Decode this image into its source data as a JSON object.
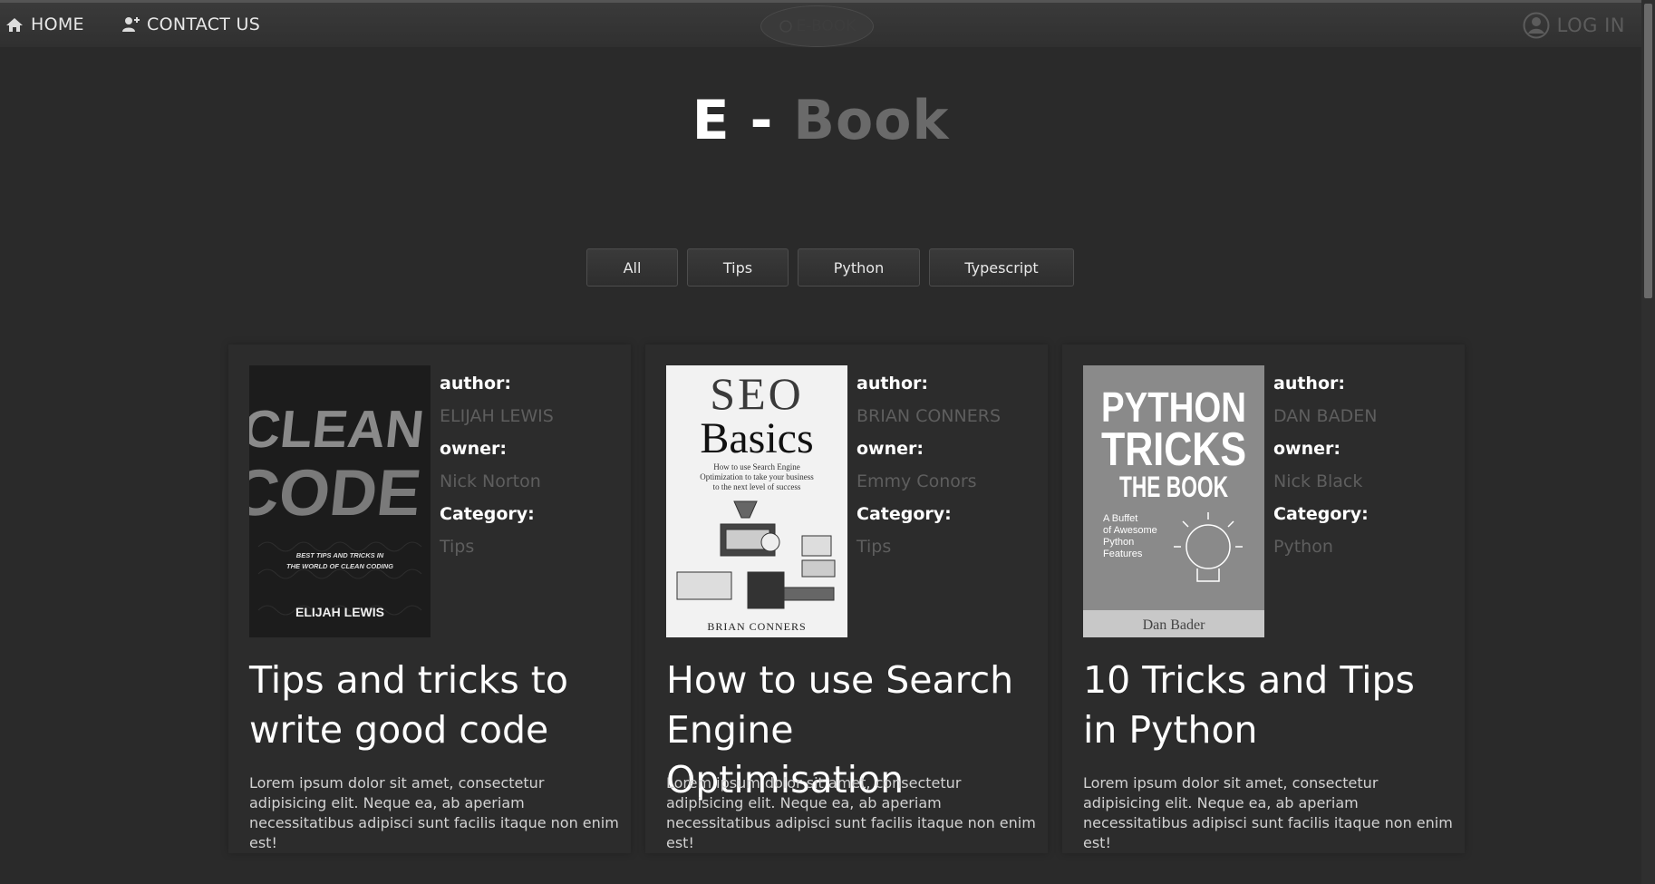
{
  "nav": {
    "home_label": "HOME",
    "contact_label": "CONTACT US",
    "brand_label": "E-BOOK",
    "login_label": "LOG IN"
  },
  "hero": {
    "e": "E",
    "dash": "-",
    "book": "Book"
  },
  "filters": [
    {
      "label": "All"
    },
    {
      "label": "Tips"
    },
    {
      "label": "Python"
    },
    {
      "label": "Typescript"
    }
  ],
  "labels": {
    "author": "author:",
    "owner": "owner:",
    "category": "Category:"
  },
  "books": [
    {
      "author": "ELIJAH LEWIS",
      "owner": "Nick Norton",
      "category": "Tips",
      "title": "Tips and tricks to write good code",
      "description": "Lorem ipsum dolor sit amet, consectetur adipisicing elit. Neque ea, ab aperiam necessitatibus adipisci sunt facilis itaque non enim est!",
      "cover": {
        "line1": "CLEAN",
        "line2": "CODE",
        "tagline1": "BEST TIPS AND TRICKS IN",
        "tagline2": "THE WORLD OF CLEAN CODING",
        "author": "ELIJAH LEWIS"
      }
    },
    {
      "author": "BRIAN CONNERS",
      "owner": "Emmy Conors",
      "category": "Tips",
      "title": "How to use Search Engine Optimisation",
      "description": "Lorem ipsum dolor sit amet, consectetur adipisicing elit. Neque ea, ab aperiam necessitatibus adipisci sunt facilis itaque non enim est!",
      "cover": {
        "line1": "SEO",
        "line2": "Basics",
        "tagline1": "How to use Search Engine",
        "tagline2": "Optimization to take your business",
        "tagline3": "to the next level of success",
        "author": "BRIAN CONNERS"
      }
    },
    {
      "author": "DAN BADEN",
      "owner": "Nick Black",
      "category": "Python",
      "title": "10 Tricks and Tips in Python",
      "description": "Lorem ipsum dolor sit amet, consectetur adipisicing elit. Neque ea, ab aperiam necessitatibus adipisci sunt facilis itaque non enim est!",
      "cover": {
        "line1": "PYTHON",
        "line2": "TRICKS",
        "line3": "THE BOOK",
        "tagline1": "A Buffet",
        "tagline2": "of Awesome",
        "tagline3": "Python",
        "tagline4": "Features",
        "author": "Dan Bader"
      }
    }
  ]
}
